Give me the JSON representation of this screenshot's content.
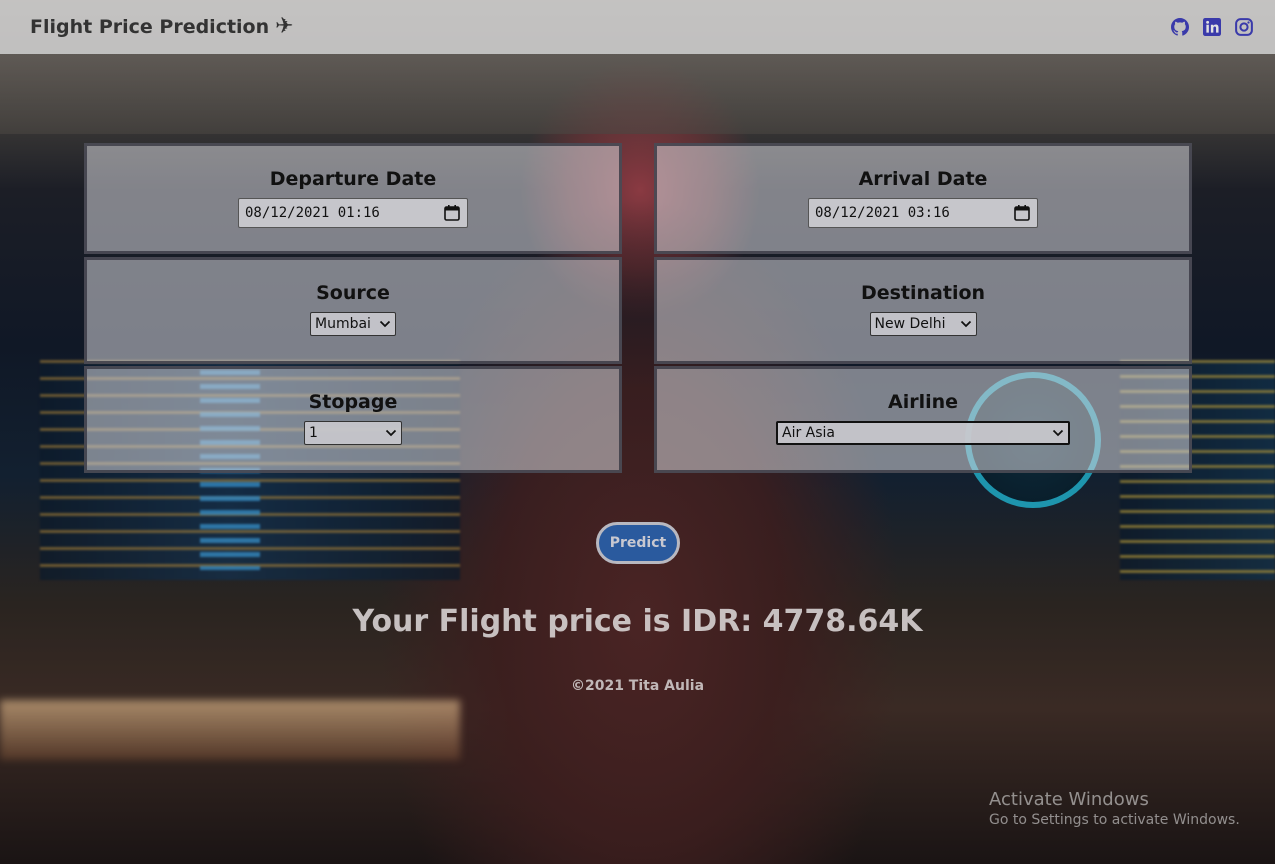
{
  "navbar": {
    "brand": "Flight Price Prediction",
    "brand_icon": "plane-icon",
    "social": [
      "github-icon",
      "linkedin-icon",
      "instagram-icon"
    ],
    "social_color": "#3a3aaa"
  },
  "form": {
    "departure": {
      "label": "Departure Date",
      "value": "08/12/2021 01:16"
    },
    "arrival": {
      "label": "Arrival Date",
      "value": "08/12/2021 03:16"
    },
    "source": {
      "label": "Source",
      "value": "Mumbai"
    },
    "destination": {
      "label": "Destination",
      "value": "New Delhi"
    },
    "stopage": {
      "label": "Stopage",
      "value": "1"
    },
    "airline": {
      "label": "Airline",
      "value": "Air Asia"
    }
  },
  "predict_label": "Predict",
  "result_text": "Your Flight price is IDR: 4778.64K",
  "footer": "©2021 Tita Aulia",
  "watermark": {
    "line1": "Activate Windows",
    "line2": "Go to Settings to activate Windows."
  },
  "colors": {
    "button_bg": "#2a5a9e",
    "navbar_bg": "#e1e1e1"
  }
}
